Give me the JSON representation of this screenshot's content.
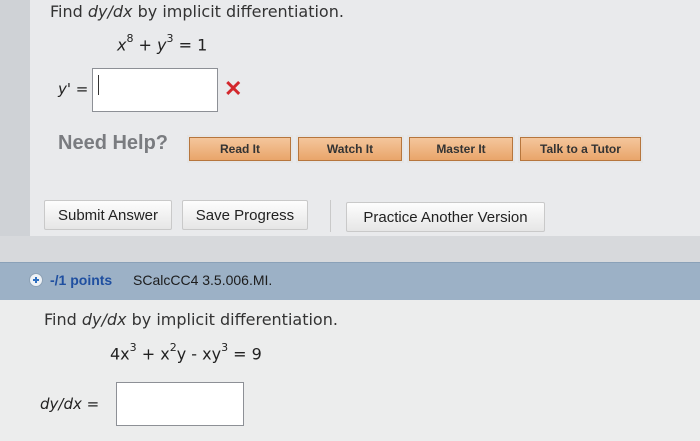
{
  "q1": {
    "prompt_prefix": "Find ",
    "prompt_var": "dy/dx",
    "prompt_suffix": " by implicit differentiation.",
    "eq": {
      "t1": "x",
      "e1": "8",
      "op1": " + ",
      "t2": "y",
      "e2": "3",
      "tail": " = 1"
    },
    "answer_label": "y' =",
    "answer_value": "",
    "mark": "✕"
  },
  "help": {
    "label": "Need Help?",
    "buttons": [
      "Read It",
      "Watch It",
      "Master It",
      "Talk to a Tutor"
    ]
  },
  "actions": {
    "submit": "Submit Answer",
    "save": "Save Progress",
    "practice": "Practice Another Version"
  },
  "q2": {
    "points": "-/1 points",
    "problem_id": "SCalcCC4 3.5.006.MI.",
    "prompt_prefix": "Find ",
    "prompt_var": "dy/dx",
    "prompt_suffix": " by implicit differentiation.",
    "eq": {
      "a": "4x",
      "e1": "3",
      "b": " + x",
      "e2": "2",
      "c": "y - xy",
      "e3": "3",
      "d": " = 9"
    },
    "answer_label": "dy/dx =",
    "answer_value": ""
  },
  "colors": {
    "accent_orange": "#e9a56a",
    "header_blue": "#9cb1c6",
    "points_blue": "#1f4fa0",
    "error_red": "#d3282d"
  }
}
